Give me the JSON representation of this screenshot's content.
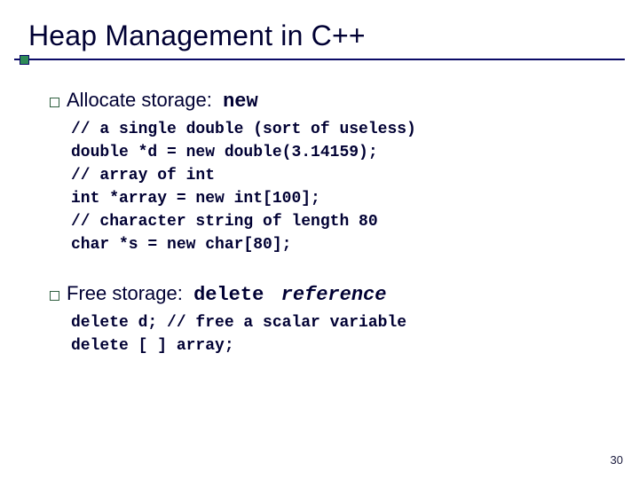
{
  "title": "Heap Management in C++",
  "bullets": {
    "alloc": {
      "label": "Allocate storage:",
      "keyword": "new",
      "code": "// a single double (sort of useless)\ndouble *d = new double(3.14159);\n// array of int\nint *array = new int[100];\n// character string of length 80\nchar *s = new char[80];"
    },
    "free": {
      "label": "Free storage:",
      "keyword": "delete",
      "ref": "reference",
      "code": "delete d; // free a scalar variable\ndelete [ ] array;"
    }
  },
  "page": "30"
}
